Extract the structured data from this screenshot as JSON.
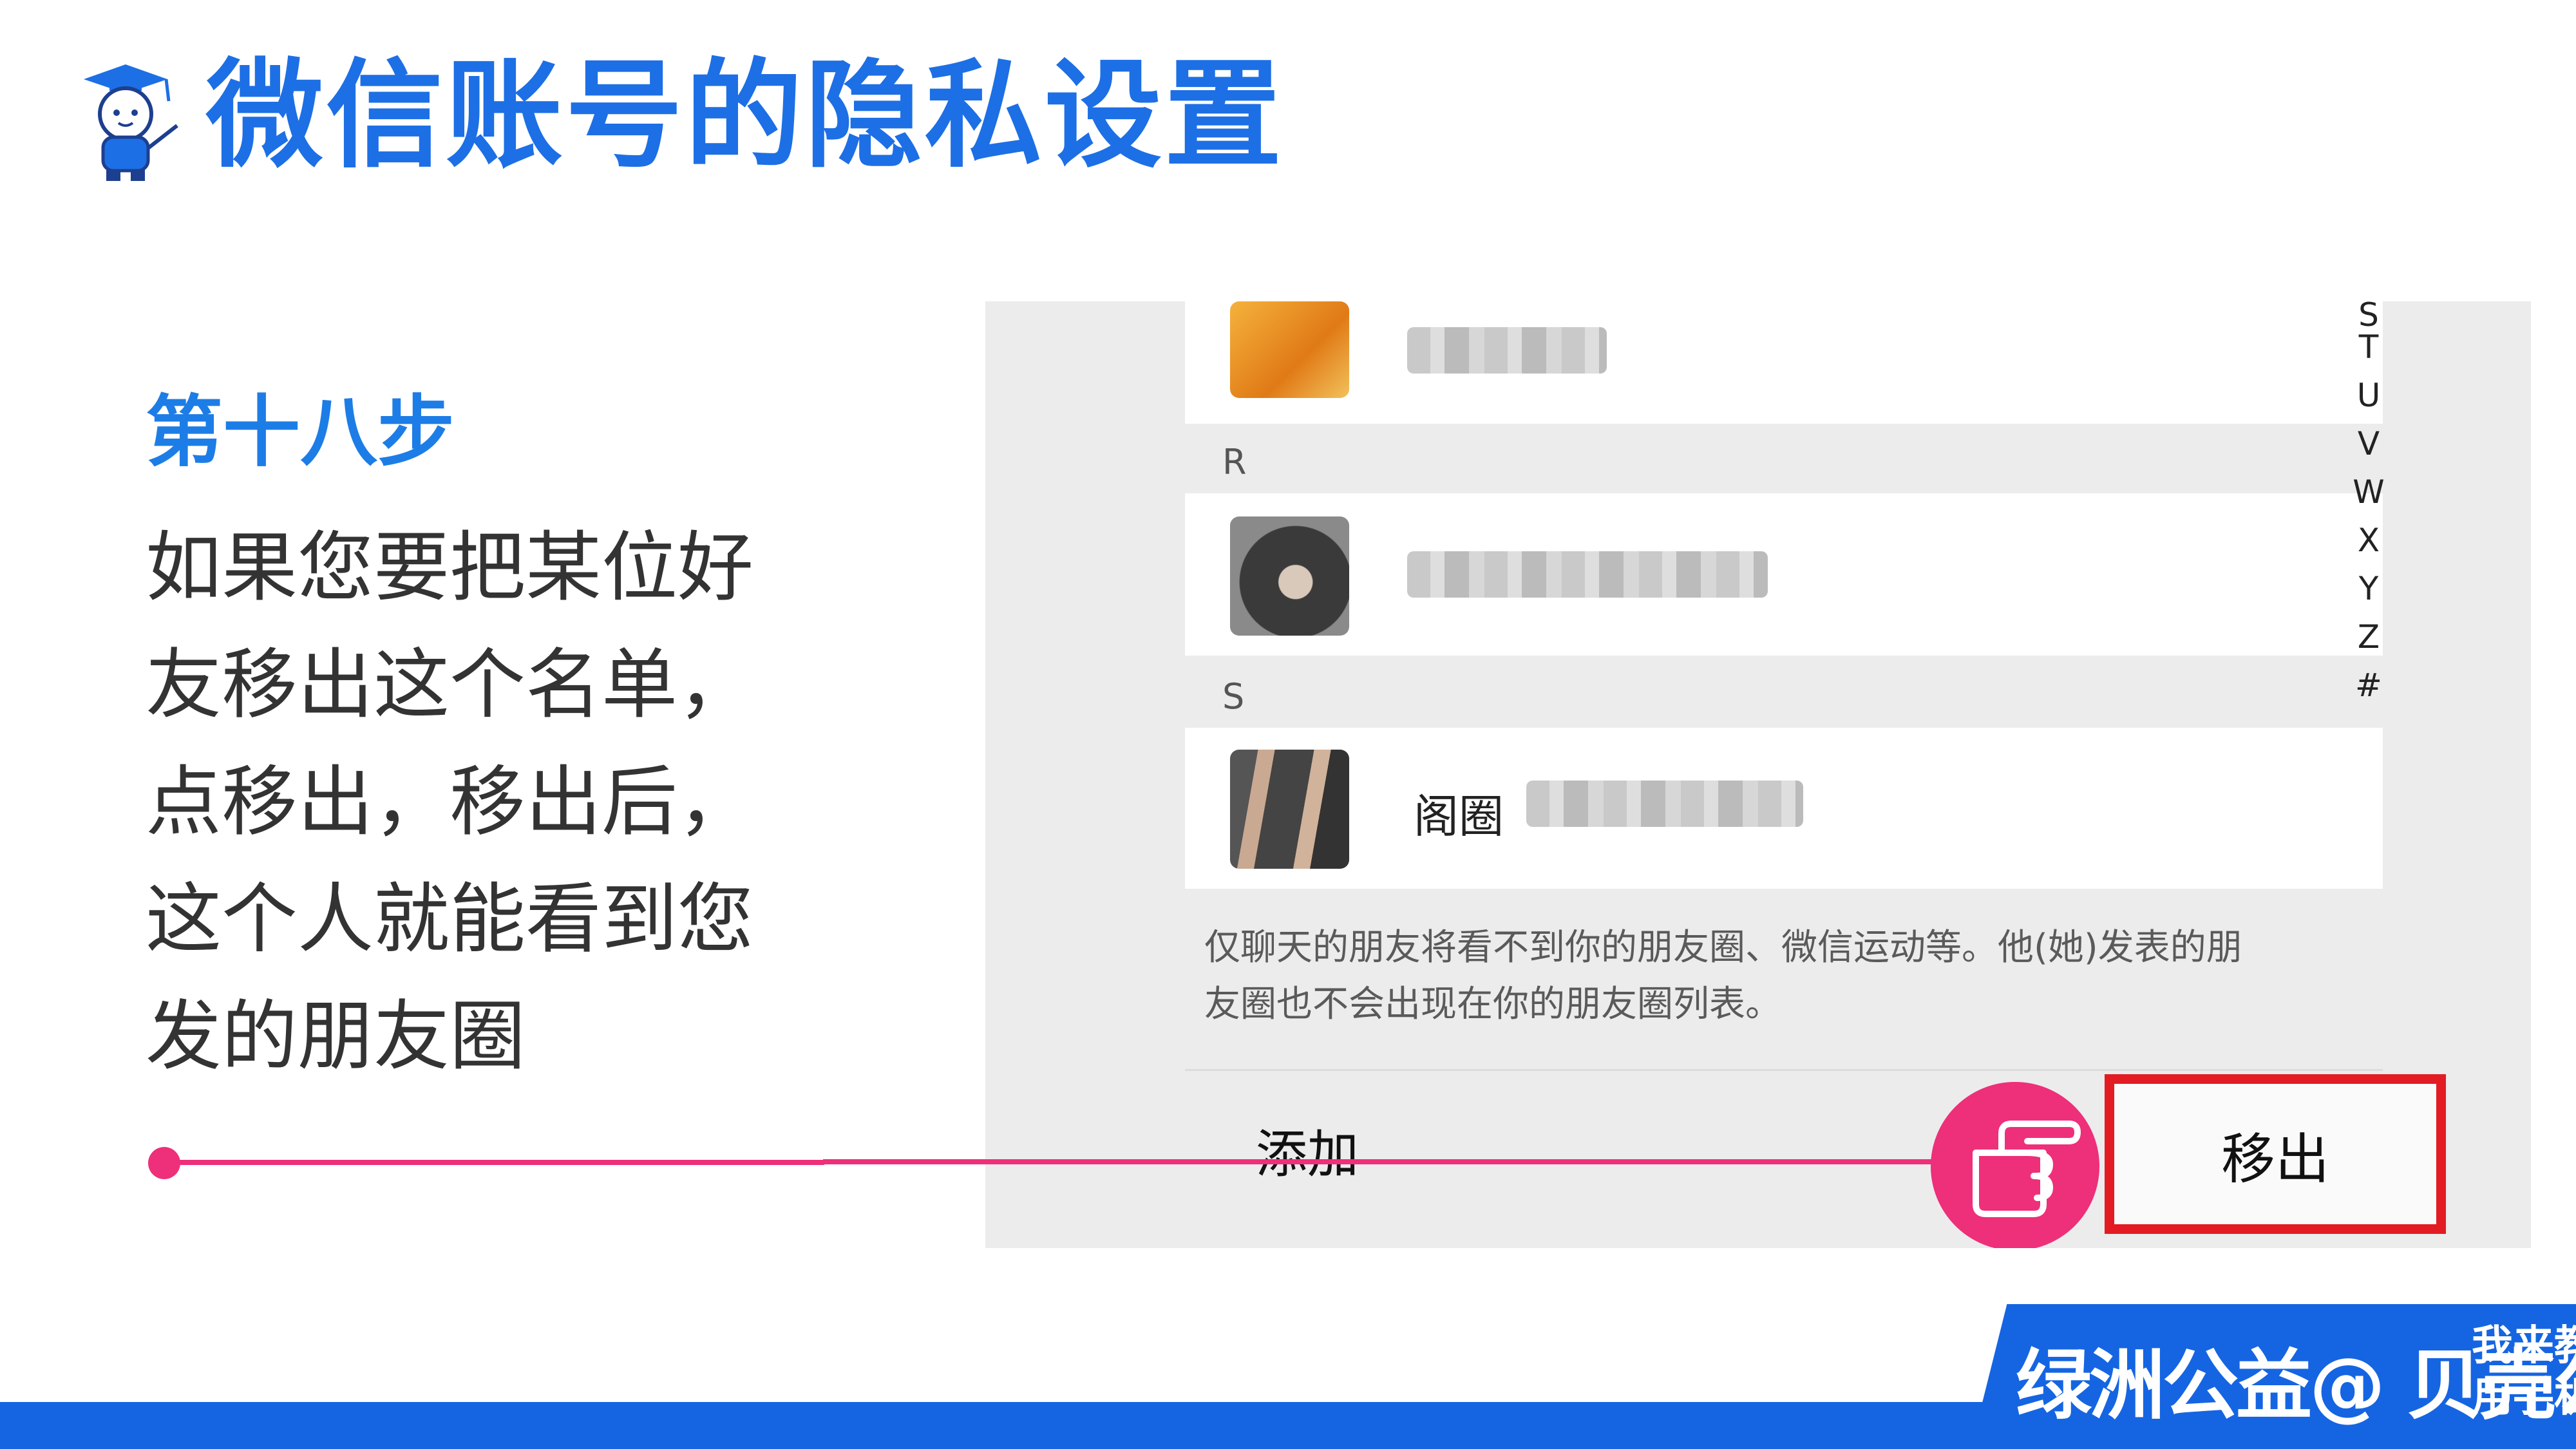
{
  "slide": {
    "title": "微信账号的隐私设置",
    "step_title": "第十八步",
    "step_lines": [
      "如果您要把某位好",
      "友移出这个名单，",
      "点移出，移出后，",
      "这个人就能看到您",
      "发的朋友圈"
    ]
  },
  "phone": {
    "sections": [
      "R",
      "S"
    ],
    "partial_name": "阁圈",
    "index_letters": [
      "T",
      "U",
      "V",
      "W",
      "X",
      "Y",
      "Z",
      "#"
    ],
    "notice_lines": [
      "仅聊天的朋友将看不到你的朋友圈、微信运动等。他(她)发表的朋",
      "友圈也不会出现在你的朋友圈列表。"
    ],
    "add_label": "添加",
    "remove_label": "移出"
  },
  "footer": {
    "brand": "绿洲公益@ 贝壳公益",
    "tagline_lines": [
      "我来教您",
      "用手机"
    ]
  },
  "colors": {
    "title_blue": "#1d6fe5",
    "accent_pink": "#ee2f7a",
    "highlight_red": "#e31b23",
    "footer_blue": "#1565e2"
  },
  "icons": [
    "teacher-mascot-icon",
    "pointing-hand-icon"
  ]
}
